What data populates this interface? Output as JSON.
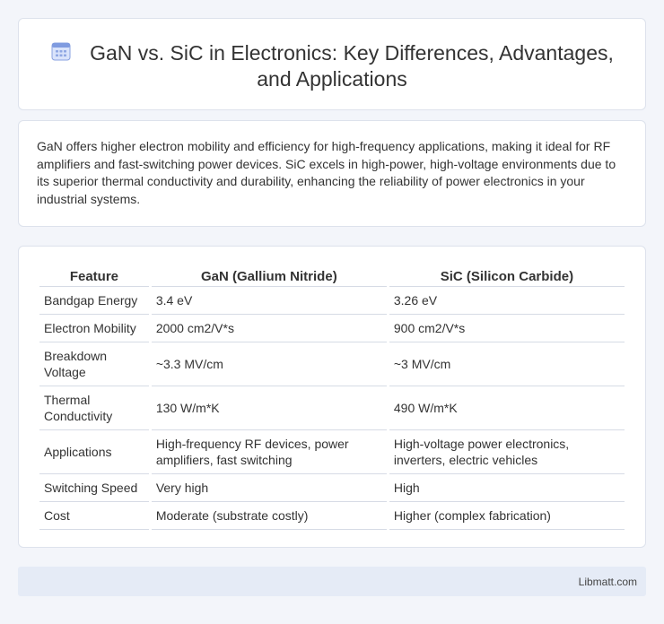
{
  "header": {
    "title": "GaN vs. SiC in Electronics: Key Differences, Advantages, and Applications",
    "icon": "calendar-icon"
  },
  "intro": {
    "text": "GaN offers higher electron mobility and efficiency for high-frequency applications, making it ideal for RF amplifiers and fast-switching power devices. SiC excels in high-power, high-voltage environments due to its superior thermal conductivity and durability, enhancing the reliability of power electronics in your industrial systems."
  },
  "table": {
    "headers": [
      "Feature",
      "GaN (Gallium Nitride)",
      "SiC (Silicon Carbide)"
    ],
    "rows": [
      [
        "Bandgap Energy",
        "3.4 eV",
        "3.26 eV"
      ],
      [
        "Electron Mobility",
        "2000 cm2/V*s",
        "900 cm2/V*s"
      ],
      [
        "Breakdown Voltage",
        "~3.3 MV/cm",
        "~3 MV/cm"
      ],
      [
        "Thermal Conductivity",
        "130 W/m*K",
        "490 W/m*K"
      ],
      [
        "Applications",
        "High-frequency RF devices, power amplifiers, fast switching",
        "High-voltage power electronics, inverters, electric vehicles"
      ],
      [
        "Switching Speed",
        "Very high",
        "High"
      ],
      [
        "Cost",
        "Moderate (substrate costly)",
        "Higher (complex fabrication)"
      ]
    ]
  },
  "footer": {
    "site": "Libmatt.com"
  },
  "colors": {
    "background": "#f3f5fa",
    "footer_bg": "#e5ebf6",
    "icon_accent": "#6f8ed8"
  }
}
